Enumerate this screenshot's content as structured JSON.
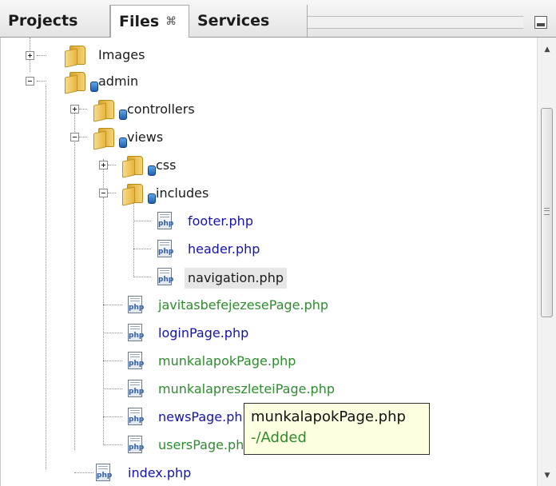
{
  "tabs": [
    {
      "label": "Projects",
      "active": false
    },
    {
      "label": "Files",
      "active": true,
      "close_glyph": "⌘"
    },
    {
      "label": "Services",
      "active": false
    }
  ],
  "colors": {
    "modified": "#1414a8",
    "added": "#2e8b2e",
    "normal": "#1a1a1a",
    "tooltip_bg": "#ffffe1"
  },
  "tree": {
    "images": "Images",
    "admin": "admin",
    "controllers": "controllers",
    "views": "views",
    "css": "css",
    "includes": "includes",
    "footer": "footer.php",
    "header": "header.php",
    "navigation": "navigation.php",
    "javitas": "javitasbefejezesePage.php",
    "login": "loginPage.php",
    "munkalapok": "munkalapokPage.php",
    "munkalapreszletei": "munkalapreszleteiPage.php",
    "news": "newsPage.php",
    "users": "usersPage.php",
    "index": "index.php"
  },
  "tooltip": {
    "title": "munkalapokPage.php",
    "status": "-/Added"
  },
  "icons": {
    "folder": "folder-icon",
    "php_file": "php-file-icon",
    "vcs_badge": "vcs-badge-icon",
    "php_text": "php"
  }
}
